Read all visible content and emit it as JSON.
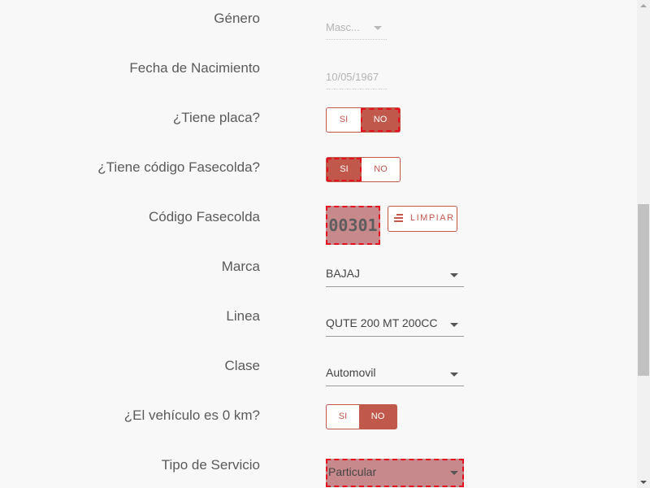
{
  "form": {
    "genero": {
      "label": "Género",
      "value": "Masc..."
    },
    "fecha_nacimiento": {
      "label": "Fecha de Nacimiento",
      "value": "10/05/1967"
    },
    "tiene_placa": {
      "label": "¿Tiene placa?",
      "options": [
        "SI",
        "NO"
      ],
      "selected": "NO"
    },
    "tiene_fasecolda": {
      "label": "¿Tiene código Fasecolda?",
      "options": [
        "SI",
        "NO"
      ],
      "selected": "SI"
    },
    "codigo_fasecolda": {
      "label": "Código Fasecolda",
      "value": "00301",
      "clear_button": "LIMPIAR"
    },
    "marca": {
      "label": "Marca",
      "value": "BAJAJ"
    },
    "linea": {
      "label": "Linea",
      "value": "QUTE 200 MT 200CC"
    },
    "clase": {
      "label": "Clase",
      "value": "Automovil"
    },
    "vehiculo_0km": {
      "label": "¿El vehículo es 0 km?",
      "options": [
        "SI",
        "NO"
      ],
      "selected": "NO"
    },
    "tipo_servicio": {
      "label": "Tipo de Servicio",
      "value": "Particular"
    }
  },
  "colors": {
    "accent": "#c0584b",
    "focus_fill": "#c8898c",
    "focus_outline": "#e3101d",
    "background": "#f8f8f8"
  }
}
